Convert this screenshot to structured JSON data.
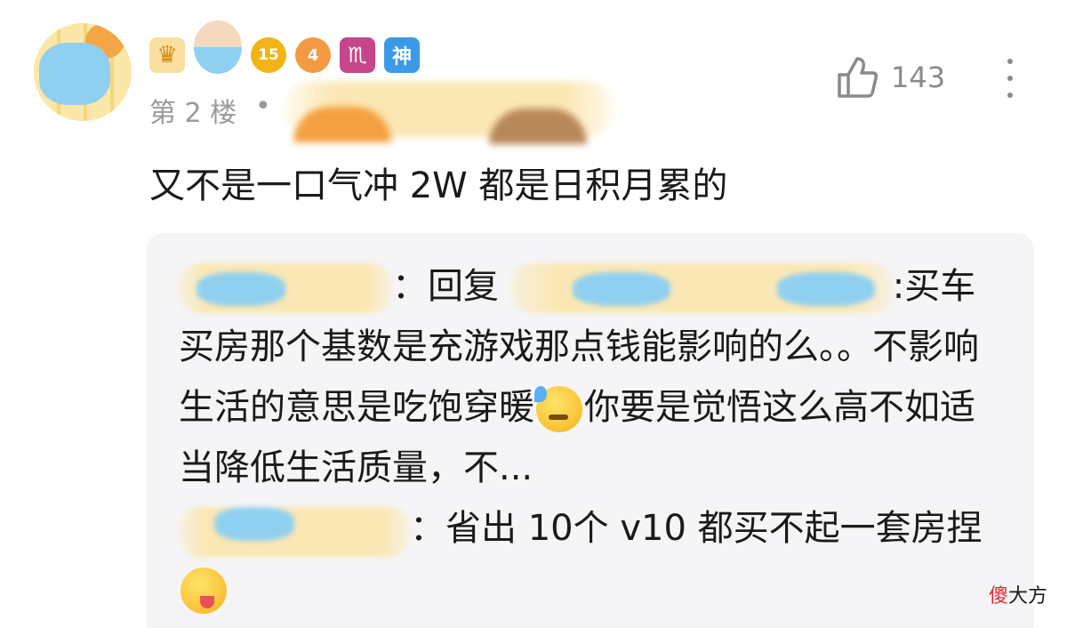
{
  "post": {
    "level_number": "15",
    "heart_level": "4",
    "zodiac_badge": "♏",
    "god_badge": "神",
    "floor": "第 2 楼",
    "separator": "•",
    "content": "又不是一口气冲 2W 都是日积月累的",
    "like_count": "143",
    "icons": [
      "crown-icon",
      "thumbs-up-icon",
      "more-vertical-icon"
    ]
  },
  "replies": {
    "reply1_prefix": "：回复",
    "reply1_text_a": ":买车买房那个基数是充游戏那点钱能影响的么。。不影响生活的意思是吃饱穿暖",
    "reply1_text_b": "你要是觉悟这么高不如适当降低生活质量，不...",
    "reply2_prefix": "：省出 10个 v10 都买不起一套房捏"
  },
  "watermark": {
    "part1": "傻",
    "part2": "大方"
  }
}
